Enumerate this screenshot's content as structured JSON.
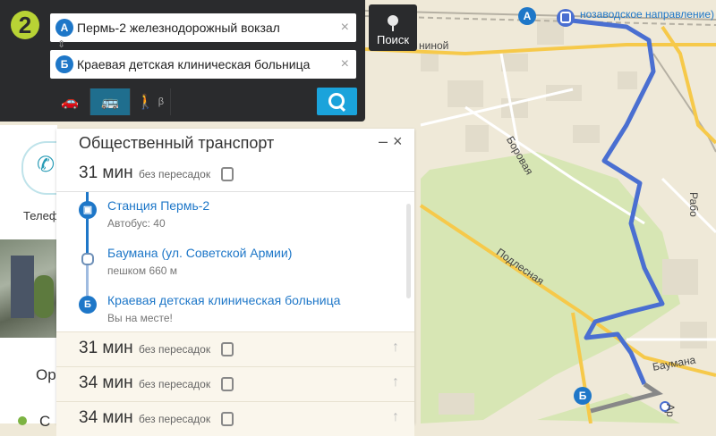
{
  "app": {
    "logo_text": "2"
  },
  "search": {
    "from_value": "Пермь-2 железнодорожный вокзал",
    "to_value": "Краевая детская клиническая больница",
    "from_pin": "А",
    "to_pin": "Б",
    "clear_glyph": "×",
    "search_label": "Поиск",
    "modes": [
      {
        "name": "car",
        "glyph": "🚗"
      },
      {
        "name": "bus",
        "glyph": "🚌",
        "active": true
      },
      {
        "name": "walk",
        "glyph": "🚶",
        "beta": "β"
      }
    ]
  },
  "side": {
    "phone_label": "Телеф",
    "text_or": "Ор",
    "text_c": "С"
  },
  "route_panel": {
    "title": "Общественный транспорт",
    "minimize": "–",
    "close": "×",
    "active_option": {
      "time": "31 мин",
      "desc": "без пересадок",
      "steps": [
        {
          "name": "Станция Пермь-2",
          "sub": "Автобус: 40",
          "icon": "bus"
        },
        {
          "name": "Баумана (ул. Советской Армии)",
          "sub": "пешком 660 м",
          "icon": "dot"
        },
        {
          "name": "Краевая детская клиническая больница",
          "sub": "Вы на месте!",
          "icon": "Б"
        }
      ]
    },
    "options": [
      {
        "time": "31 мин",
        "desc": "без пересадок"
      },
      {
        "time": "34 мин",
        "desc": "без пересадок"
      },
      {
        "time": "34 мин",
        "desc": "без пересадок"
      }
    ],
    "arrow_glyph": "↑"
  },
  "map": {
    "labels": {
      "borovaya": "Боровая",
      "podlesnaya": "Подлесная",
      "baumana": "Баумана",
      "rabo": "Рабо",
      "ina": "ниной",
      "direction": "нозаводское направление)",
      "ar": "Ар"
    },
    "pin_a": "А",
    "pin_b": "Б",
    "colors": {
      "route": "#4a6fd1",
      "walk": "#888888",
      "forest": "#d7e6b4",
      "road": "#f6c94a"
    }
  }
}
